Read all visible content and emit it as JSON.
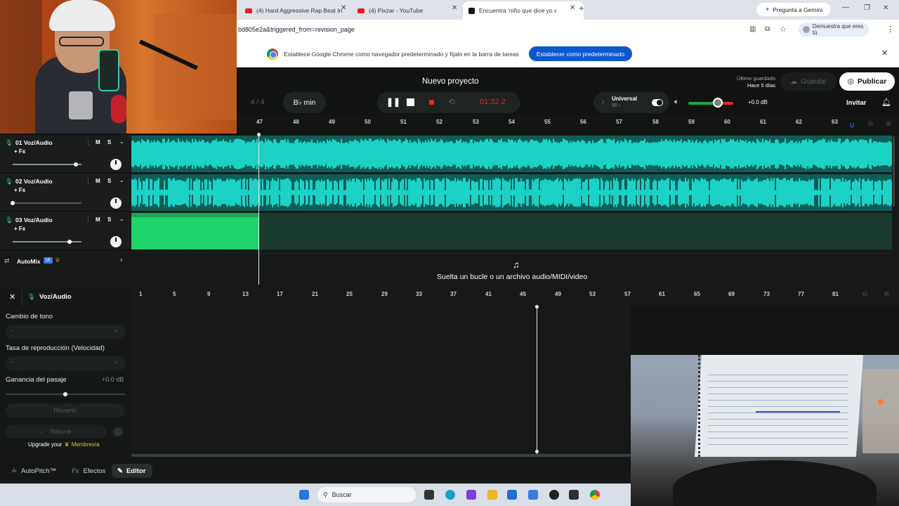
{
  "browser": {
    "tabs": [
      {
        "label": "(4) Hard Aggressive Rap Beat In",
        "icon": "youtube-icon"
      },
      {
        "label": "(4) Pixzar - YouTube",
        "icon": "youtube-icon"
      },
      {
        "label": "Encuentra 'niño que dice yo se",
        "icon": "tiktok-icon"
      }
    ],
    "gemini_button": "Pregunta a Gemini",
    "url": "bd805e2a&triggered_from=revision_page",
    "profile_label": "Demuestra que eres tú",
    "infobar_text": "Establece Google Chrome como navegador predeterminado y fíjalo en la barra de tareas",
    "infobar_button": "Establecer como predeterminado"
  },
  "app": {
    "project_title": "Nuevo proyecto",
    "last_saved_label": "Último guardado",
    "last_saved_value": "Hace 5 días",
    "save_button": "Guardar",
    "publish_button": "Publicar",
    "time_signature": "4 / 4",
    "key": "B♭ min",
    "time": "01:32.2",
    "instrument_name": "Universal",
    "instrument_sub": "50 ›",
    "volume_db": "+0.0 dB",
    "invite_button": "Invitar",
    "accent_color": "#1cd1c6",
    "record_color": "#e5272c"
  },
  "ruler": [
    "47",
    "48",
    "49",
    "50",
    "51",
    "52",
    "53",
    "54",
    "55",
    "56",
    "57",
    "58",
    "59",
    "60",
    "61",
    "62",
    "63"
  ],
  "tracks": [
    {
      "name": "01  Voz/Audio",
      "fx": "+ Fx",
      "m": "M",
      "s": "S",
      "volume_level": 0.92
    },
    {
      "name": "02  Voz/Audio",
      "fx": "+ Fx",
      "m": "M",
      "s": "S",
      "volume_level": 0.0
    },
    {
      "name": "03  Voz/Audio",
      "fx": "+ Fx",
      "m": "M",
      "s": "S",
      "volume_level": 0.83
    }
  ],
  "automix": {
    "label": "AutoMix",
    "badge": "IA"
  },
  "drop_text": "Suelta un bucle o un archivo audio/MIDI/video",
  "editor": {
    "title": "Voz/Audio",
    "pitch_label": "Cambio de tono",
    "rate_label": "Tasa de reproducción (Velocidad)",
    "gain_label": "Ganancia del pasaje",
    "gain_value": "+0.0 dB",
    "revert_button": "Revertir",
    "retune_button": "Retune",
    "upgrade_text": "Upgrade your",
    "membership": "Membresía",
    "tab_autopitch": "AutoPitch™",
    "tab_effects": "Efectos",
    "tab_editor": "Editor",
    "ruler": [
      "1",
      "5",
      "9",
      "13",
      "17",
      "21",
      "25",
      "29",
      "33",
      "37",
      "41",
      "45",
      "49",
      "53",
      "57",
      "61",
      "65",
      "69",
      "73",
      "77",
      "81"
    ]
  },
  "taskbar": {
    "search_placeholder": "Buscar"
  }
}
